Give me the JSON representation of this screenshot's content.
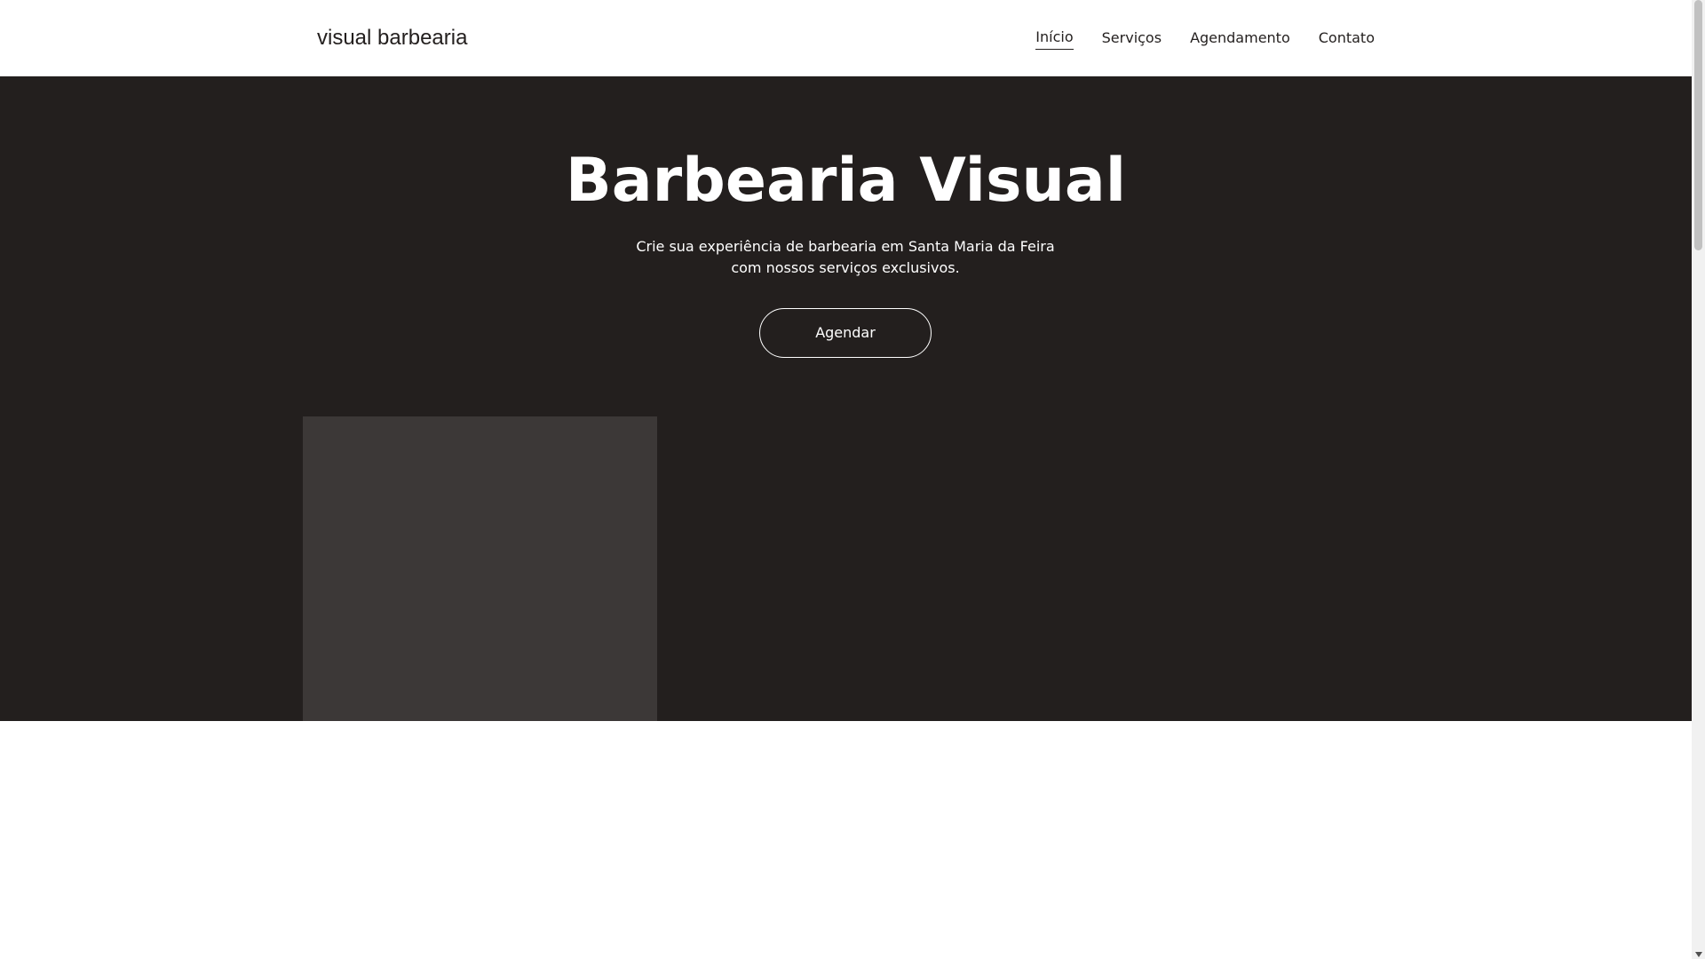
{
  "header": {
    "brand": "visual barbearia",
    "nav": [
      {
        "label": "Início",
        "active": true
      },
      {
        "label": "Serviços",
        "active": false
      },
      {
        "label": "Agendamento",
        "active": false
      },
      {
        "label": "Contato",
        "active": false
      }
    ]
  },
  "hero": {
    "title": "Barbearia Visual",
    "subtitle_line1": "Crie sua experiência de barbearia em Santa Maria da Feira",
    "subtitle_line2": "com nossos serviços exclusivos.",
    "button_label": "Agendar"
  },
  "colors": {
    "hero_background": "#231f1e",
    "placeholder": "#3c3837",
    "text_light": "#ffffff",
    "text_dark": "#231f1e"
  }
}
